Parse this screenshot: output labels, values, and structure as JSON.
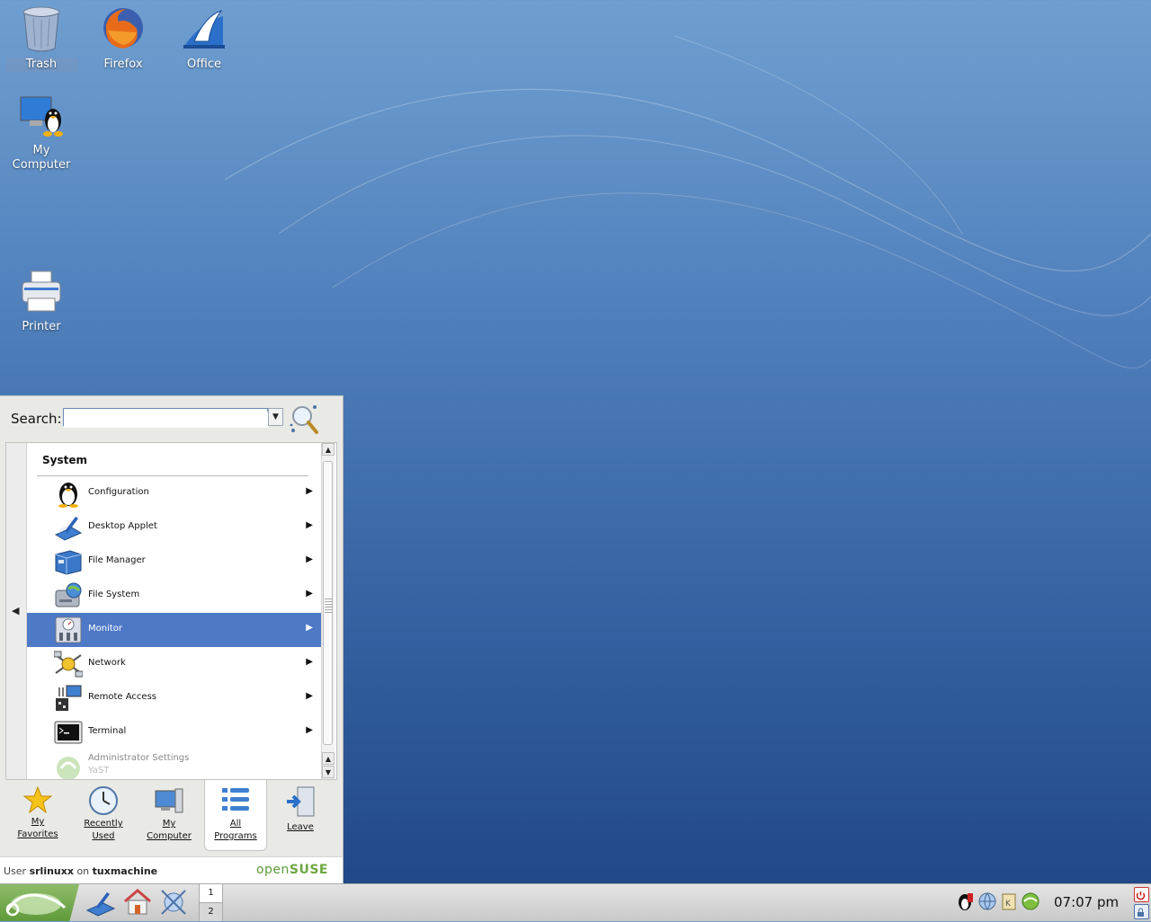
{
  "desktop": {
    "icons": [
      {
        "label": "Trash",
        "icon": "trash-icon"
      },
      {
        "label": "Firefox",
        "icon": "firefox-icon"
      },
      {
        "label": "Office",
        "icon": "office-icon"
      },
      {
        "label": "My Computer",
        "icon": "my-computer-icon"
      },
      {
        "label": "Printer",
        "icon": "printer-icon"
      }
    ]
  },
  "menu": {
    "search_label": "Search:",
    "search_value": "",
    "section_title": "System",
    "items": [
      {
        "label": "Configuration",
        "icon": "tux-icon"
      },
      {
        "label": "Desktop Applet",
        "icon": "desktop-applet-icon"
      },
      {
        "label": "File Manager",
        "icon": "file-manager-icon"
      },
      {
        "label": "File System",
        "icon": "file-system-icon"
      },
      {
        "label": "Monitor",
        "icon": "monitor-icon",
        "selected": true
      },
      {
        "label": "Network",
        "icon": "network-icon"
      },
      {
        "label": "Remote Access",
        "icon": "remote-access-icon"
      },
      {
        "label": "Terminal",
        "icon": "terminal-icon"
      },
      {
        "label": "Administrator Settings",
        "sublabel": "YaST",
        "icon": "yast-icon"
      }
    ],
    "tabs": [
      {
        "line1": "My",
        "line2": "Favorites",
        "icon": "star-icon"
      },
      {
        "line1": "Recently",
        "line2": "Used",
        "icon": "clock-icon"
      },
      {
        "line1": "My",
        "line2": "Computer",
        "icon": "computer-icon"
      },
      {
        "line1": "All",
        "line2": "Programs",
        "icon": "list-icon",
        "active": true
      },
      {
        "line1": "Leave",
        "line2": "",
        "icon": "leave-icon"
      }
    ],
    "footer": {
      "prefix": "User",
      "user": "srlinuxx",
      "mid": "on",
      "host": "tuxmachine",
      "logo_open": "open",
      "logo_suse": "SUSE"
    }
  },
  "taskbar": {
    "pager": [
      "1",
      "2"
    ],
    "clock": "07:07 pm"
  },
  "colors": {
    "selection": "#4e79c7",
    "suse_green": "#6da741"
  }
}
